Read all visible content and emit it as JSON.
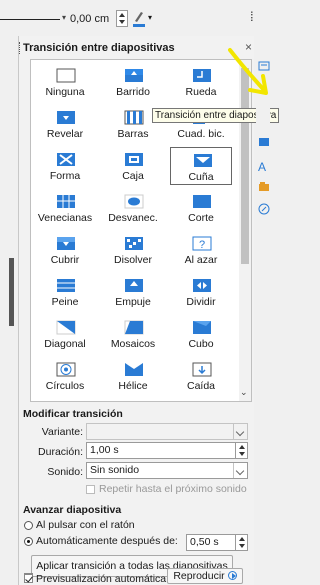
{
  "toolbar": {
    "value": "0,00 cm"
  },
  "panel": {
    "title": "Transición entre diapositivas",
    "close_glyph": "×",
    "transitions": [
      {
        "label": "Ninguna",
        "icon": "none-icon"
      },
      {
        "label": "Barrido",
        "icon": "wipe-icon"
      },
      {
        "label": "Rueda",
        "icon": "wheel-icon"
      },
      {
        "label": "Revelar",
        "icon": "uncover-icon"
      },
      {
        "label": "Barras",
        "icon": "bars-icon"
      },
      {
        "label": "Cuad. bic.",
        "icon": "checkers-icon"
      },
      {
        "label": "Forma",
        "icon": "shape-icon"
      },
      {
        "label": "Caja",
        "icon": "box-icon"
      },
      {
        "label": "Cuña",
        "icon": "wedge-icon",
        "selected": true
      },
      {
        "label": "Venecianas",
        "icon": "venetian-icon"
      },
      {
        "label": "Desvanec.",
        "icon": "fade-icon"
      },
      {
        "label": "Corte",
        "icon": "cut-icon"
      },
      {
        "label": "Cubrir",
        "icon": "cover-icon"
      },
      {
        "label": "Disolver",
        "icon": "dissolve-icon"
      },
      {
        "label": "Al azar",
        "icon": "random-icon"
      },
      {
        "label": "Peine",
        "icon": "comb-icon"
      },
      {
        "label": "Empuje",
        "icon": "push-icon"
      },
      {
        "label": "Dividir",
        "icon": "split-icon"
      },
      {
        "label": "Diagonal",
        "icon": "diagonal-icon"
      },
      {
        "label": "Mosaicos",
        "icon": "tiles-icon"
      },
      {
        "label": "Cubo",
        "icon": "cube-icon"
      },
      {
        "label": "Círculos",
        "icon": "circles-icon"
      },
      {
        "label": "Hélice",
        "icon": "helix-icon"
      },
      {
        "label": "Caída",
        "icon": "fall-icon"
      }
    ],
    "tooltip": "Transición entre diapositiva"
  },
  "modify": {
    "title": "Modificar transición",
    "variant_label": "Variante:",
    "variant_value": "",
    "duration_label": "Duración:",
    "duration_value": "1,00 s",
    "sound_label": "Sonido:",
    "sound_value": "Sin sonido",
    "repeat_label": "Repetir hasta el próximo sonido"
  },
  "advance": {
    "title": "Avanzar diapositiva",
    "on_click_label": "Al pulsar con el ratón",
    "auto_label": "Automáticamente después de:",
    "auto_value": "0,50 s",
    "mode": "auto"
  },
  "apply_all_label": "Aplicar transición a todas las diapositivas",
  "autopreview_label": "Previsualización automática",
  "play_label": "Reproducir",
  "colors": {
    "accent": "#2a7bd4",
    "arrow": "#f2e600"
  }
}
